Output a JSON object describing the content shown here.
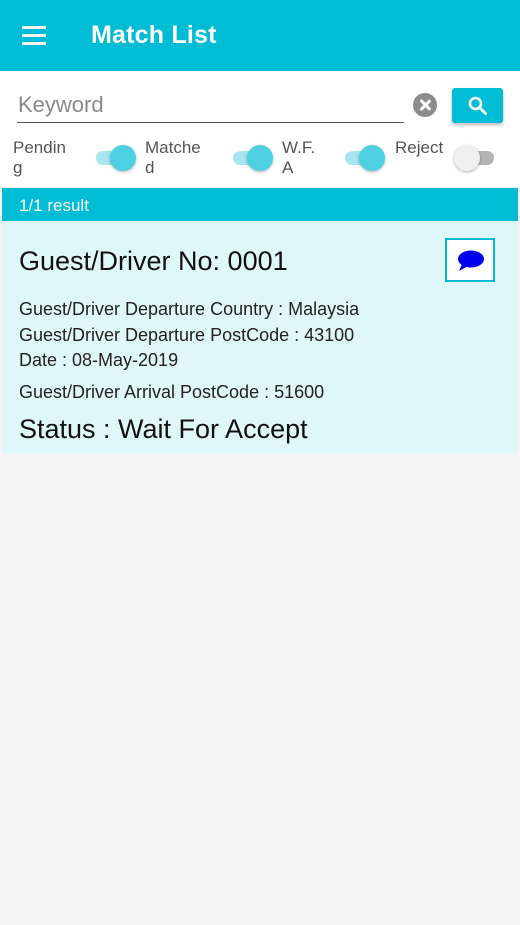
{
  "appbar": {
    "title": "Match List",
    "menu_icon": "hamburger-menu-icon",
    "background": "#00bcd4"
  },
  "search": {
    "placeholder": "Keyword",
    "value": "",
    "clear_icon": "clear-circle-icon",
    "button_icon": "search-icon"
  },
  "filters": [
    {
      "label": "Pending",
      "on": true
    },
    {
      "label": "Matched",
      "on": true
    },
    {
      "label": "W.F.A",
      "on": true
    },
    {
      "label": "Reject",
      "on": false
    }
  ],
  "result": {
    "count_text": "1/1 result"
  },
  "card": {
    "title": "Guest/Driver No: 0001",
    "chat_icon": "chat-bubble-icon",
    "departure_country": "Guest/Driver Departure Country :  Malaysia",
    "departure_postcode": "Guest/Driver Departure PostCode : 43100",
    "date": "Date : 08-May-2019",
    "arrival_postcode": "Guest/Driver Arrival PostCode : 51600",
    "status": "Status : Wait For Accept"
  },
  "colors": {
    "accent": "#00bcd4",
    "card_background": "#e0f7fa",
    "toggle_on": "#4dd0e1",
    "chat_icon": "#0000ee"
  }
}
